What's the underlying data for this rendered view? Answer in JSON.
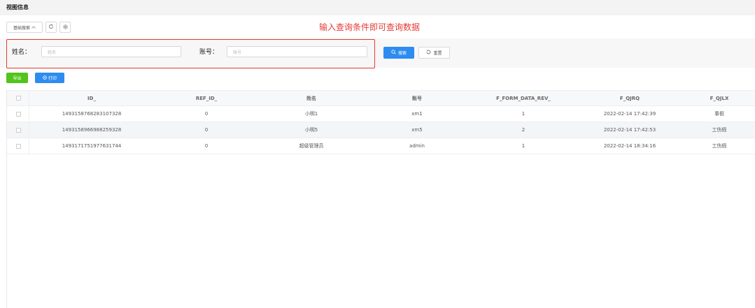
{
  "page": {
    "title": "视图信息"
  },
  "toolbar": {
    "advanced_search_label": "基础搜索",
    "chevron": "^",
    "refresh_icon": "refresh-icon",
    "settings_icon": "gear-icon"
  },
  "hint": "输入查询条件即可查询数据",
  "search": {
    "name_label": "姓名：",
    "name_placeholder": "姓名",
    "account_label": "账号：",
    "account_placeholder": "账号",
    "search_button": "搜索",
    "reset_button": "重置"
  },
  "actions": {
    "export_label": "导出",
    "print_label": "打印"
  },
  "colors": {
    "accent": "#2d8cf0",
    "export": "#52c41a",
    "highlight": "#e53935"
  },
  "table": {
    "columns": [
      "ID_",
      "REF_ID_",
      "姓名",
      "账号",
      "F_FORM_DATA_REV_",
      "F_QJRQ",
      "F_QJLX"
    ],
    "rows": [
      [
        "1493158768283107328",
        "0",
        "小明1",
        "xm1",
        "1",
        "2022-02-14 17:42:39",
        "事假"
      ],
      [
        "1493158966988259328",
        "0",
        "小明5",
        "xm5",
        "2",
        "2022-02-14 17:42:53",
        "工伤假"
      ],
      [
        "1493171751977631744",
        "0",
        "超级管理员",
        "admin",
        "1",
        "2022-02-14 18:34:16",
        "工伤假"
      ]
    ]
  }
}
